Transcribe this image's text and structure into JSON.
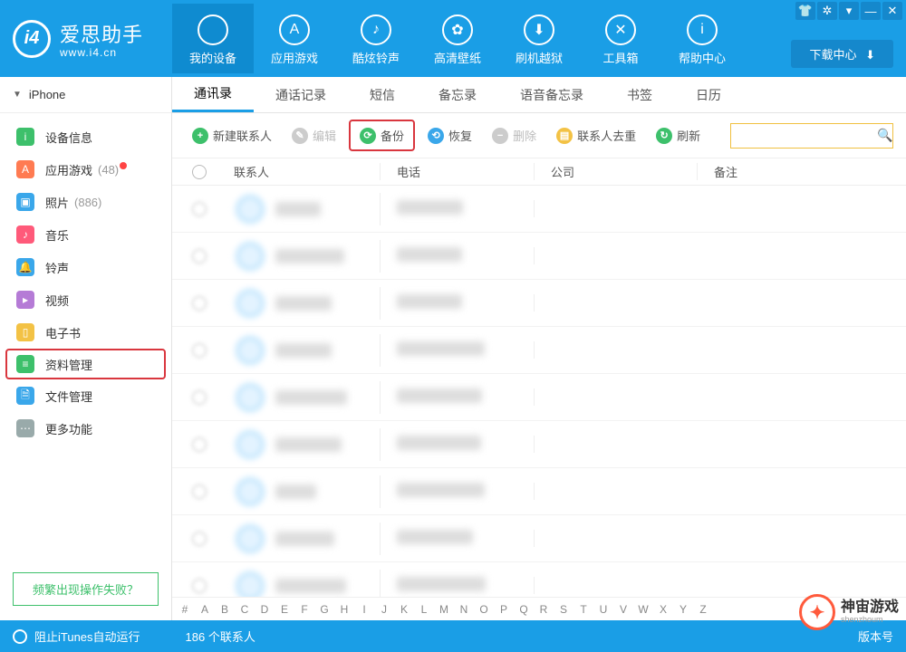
{
  "app": {
    "title_cn": "爱思助手",
    "title_url": "www.i4.cn",
    "download_center": "下载中心"
  },
  "nav": [
    {
      "label": "我的设备",
      "icon": "",
      "active": true
    },
    {
      "label": "应用游戏",
      "icon": "A"
    },
    {
      "label": "酷炫铃声",
      "icon": "♪"
    },
    {
      "label": "高清壁纸",
      "icon": "✿"
    },
    {
      "label": "刷机越狱",
      "icon": "⬇"
    },
    {
      "label": "工具箱",
      "icon": "✕"
    },
    {
      "label": "帮助中心",
      "icon": "i"
    }
  ],
  "sidebar": {
    "device": "iPhone",
    "items": [
      {
        "label": "设备信息",
        "color": "#3dc06b",
        "icon": "i"
      },
      {
        "label": "应用游戏",
        "count": "(48)",
        "dot": true,
        "color": "#ff7b52",
        "icon": "A"
      },
      {
        "label": "照片",
        "count": "(886)",
        "color": "#3aa7ea",
        "icon": "▣"
      },
      {
        "label": "音乐",
        "color": "#ff5a7a",
        "icon": "♪"
      },
      {
        "label": "铃声",
        "color": "#3aa7ea",
        "icon": "🔔"
      },
      {
        "label": "视频",
        "color": "#b57bd6",
        "icon": "▸"
      },
      {
        "label": "电子书",
        "color": "#f3c245",
        "icon": "▯"
      },
      {
        "label": "资料管理",
        "color": "#3dc06b",
        "icon": "≡",
        "highlight": true
      },
      {
        "label": "文件管理",
        "color": "#3aa7ea",
        "icon": "🗎"
      },
      {
        "label": "更多功能",
        "color": "#9aa",
        "icon": "⋯"
      }
    ],
    "faq": "频繁出现操作失败？"
  },
  "tabs": [
    "通讯录",
    "通话记录",
    "短信",
    "备忘录",
    "语音备忘录",
    "书签",
    "日历"
  ],
  "toolbar": {
    "new_contact": "新建联系人",
    "edit": "编辑",
    "backup": "备份",
    "restore": "恢复",
    "delete": "删除",
    "dedupe": "联系人去重",
    "refresh": "刷新",
    "search_placeholder": ""
  },
  "columns": {
    "contact": "联系人",
    "phone": "电话",
    "company": "公司",
    "note": "备注"
  },
  "row_count": 9,
  "alpha": [
    "#",
    "A",
    "B",
    "C",
    "D",
    "E",
    "F",
    "G",
    "H",
    "I",
    "J",
    "K",
    "L",
    "M",
    "N",
    "O",
    "P",
    "Q",
    "R",
    "S",
    "T",
    "U",
    "V",
    "W",
    "X",
    "Y",
    "Z"
  ],
  "status": {
    "left": "阻止iTunes自动运行",
    "center_count": "186",
    "center_suffix": " 个联系人",
    "right": "版本号"
  },
  "watermark": {
    "cn": "神宙游戏",
    "py": "shenzhoum"
  }
}
